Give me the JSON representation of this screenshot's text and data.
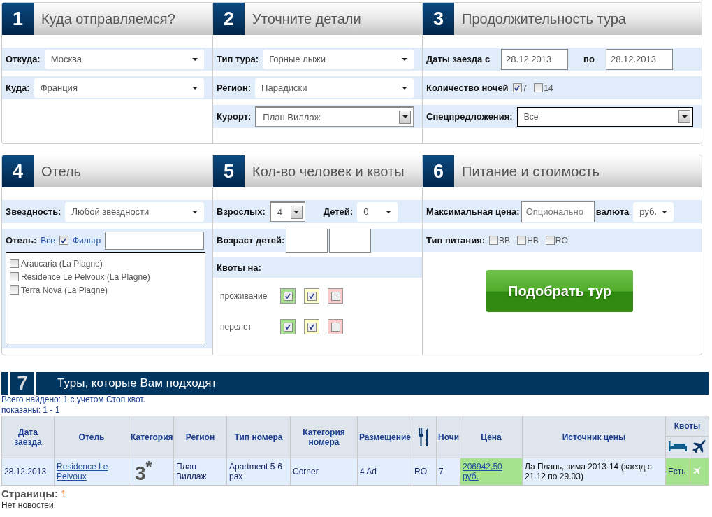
{
  "sections": [
    {
      "number": "1",
      "title": "Куда отправляемся?",
      "rows": [
        {
          "kind": "field",
          "parts": [
            {
              "kind": "label",
              "text": "Откуда:"
            },
            {
              "kind": "select",
              "value": "Москва"
            }
          ]
        },
        {
          "kind": "field",
          "parts": [
            {
              "kind": "label",
              "text": "Куда:"
            },
            {
              "kind": "select",
              "value": "Франция"
            }
          ]
        }
      ]
    },
    {
      "number": "2",
      "title": "Уточните детали",
      "rows": [
        {
          "kind": "field",
          "parts": [
            {
              "kind": "label",
              "text": "Тип тура:"
            },
            {
              "kind": "select",
              "value": "Горные лыжи"
            }
          ]
        },
        {
          "kind": "field",
          "parts": [
            {
              "kind": "label",
              "text": "Регион:"
            },
            {
              "kind": "select",
              "value": "Парадиски"
            }
          ]
        },
        {
          "kind": "field",
          "parts": [
            {
              "kind": "label",
              "text": "Курорт:"
            },
            {
              "kind": "combo",
              "value": "План Виллаж"
            }
          ]
        }
      ]
    },
    {
      "number": "3",
      "title": "Продолжительность тура",
      "rows": [
        {
          "kind": "field",
          "parts": [
            {
              "kind": "label",
              "text": "Даты заезда с"
            },
            {
              "kind": "input",
              "value": "28.12.2013"
            },
            {
              "kind": "label",
              "text": "по"
            },
            {
              "kind": "input",
              "value": "28.12.2013"
            }
          ]
        },
        {
          "kind": "field",
          "parts": [
            {
              "kind": "label",
              "text": "Количество ночей"
            },
            {
              "kind": "check",
              "text": "7",
              "checked": true
            },
            {
              "kind": "check",
              "text": "14",
              "checked": false
            }
          ]
        },
        {
          "kind": "field",
          "parts": [
            {
              "kind": "label",
              "text": "Спецпредложения:"
            },
            {
              "kind": "combo",
              "value": "Все"
            }
          ]
        }
      ]
    },
    {
      "number": "4",
      "title": "Отель",
      "rows": [
        {
          "kind": "field",
          "parts": [
            {
              "kind": "label",
              "text": "Звездность:"
            },
            {
              "kind": "select",
              "value": "Любой звездности"
            }
          ]
        },
        {
          "kind": "field",
          "parts": [
            {
              "kind": "label",
              "text": "Отель:"
            },
            {
              "kind": "link",
              "text": "Все"
            },
            {
              "kind": "check",
              "checked": true
            },
            {
              "kind": "link",
              "text": "Фильтр"
            },
            {
              "kind": "input"
            }
          ]
        },
        {
          "kind": "list",
          "items": [
            {
              "label": "Araucaria (La Plagne)",
              "checked": false
            },
            {
              "label": "Residence Le Pelvoux (La Plagne)",
              "checked": false
            },
            {
              "label": "Terra Nova (La Plagne)",
              "checked": false
            }
          ]
        }
      ]
    },
    {
      "number": "5",
      "title": "Кол-во человек и квоты",
      "rows": [
        {
          "kind": "tight",
          "parts": [
            {
              "kind": "label",
              "text": "Взрослых:"
            },
            {
              "kind": "combo",
              "value": "4"
            },
            {
              "kind": "label",
              "text": "Детей:"
            },
            {
              "kind": "select",
              "value": "0"
            }
          ]
        },
        {
          "kind": "field",
          "parts": [
            {
              "kind": "label",
              "text": "Возраст детей:"
            },
            {
              "kind": "input"
            },
            {
              "kind": "input"
            }
          ]
        },
        {
          "kind": "heading",
          "text": "Квоты на:"
        },
        {
          "kind": "quota",
          "label": "проживание",
          "checks": [
            {
              "color": "#a6df8e",
              "checked": true
            },
            {
              "color": "#ffffc8",
              "checked": true
            },
            {
              "color": "#ffcccc",
              "checked": false
            }
          ]
        },
        {
          "kind": "quota",
          "label": "перелет",
          "checks": [
            {
              "color": "#a6df8e",
              "checked": true
            },
            {
              "color": "#ffffc8",
              "checked": true
            },
            {
              "color": "#ffcccc",
              "checked": false
            }
          ]
        }
      ]
    },
    {
      "number": "6",
      "title": "Питание и стоимость",
      "rows": [
        {
          "kind": "tight",
          "parts": [
            {
              "kind": "label",
              "text": "Максимальная цена:"
            },
            {
              "kind": "input",
              "placeholder": "Опционально"
            },
            {
              "kind": "label",
              "text": "валюта"
            },
            {
              "kind": "select",
              "value": "руб."
            }
          ]
        },
        {
          "kind": "field",
          "parts": [
            {
              "kind": "label",
              "text": "Тип питания:"
            },
            {
              "kind": "check",
              "text": "BB",
              "checked": false
            },
            {
              "kind": "check",
              "text": "HB",
              "checked": false
            },
            {
              "kind": "check",
              "text": "RO",
              "checked": false
            }
          ]
        },
        {
          "kind": "action",
          "text": "Подобрать тур"
        }
      ]
    }
  ],
  "results": {
    "number": "7",
    "title": "Туры, которые Вам подходят",
    "summary": [
      "Всего найдено: 1 с учетом Стоп квот.",
      "показаны: 1 - 1"
    ],
    "table": {
      "columns": [
        {
          "kind": "text",
          "label": "Дата заезда"
        },
        {
          "kind": "text",
          "label": "Отель"
        },
        {
          "kind": "text",
          "label": "Категория"
        },
        {
          "kind": "text",
          "label": "Регион"
        },
        {
          "kind": "text",
          "label": "Тип номера"
        },
        {
          "kind": "text",
          "label": "Категория номера"
        },
        {
          "kind": "text",
          "label": "Размещение"
        },
        {
          "kind": "meal-icon"
        },
        {
          "kind": "text",
          "label": "Ночи"
        },
        {
          "kind": "text",
          "label": "Цена"
        },
        {
          "kind": "text",
          "label": "Источник цены"
        },
        {
          "kind": "group",
          "label": "Квоты",
          "subcolumns": [
            {
              "kind": "bed"
            },
            {
              "kind": "plane"
            }
          ]
        }
      ],
      "rows": [
        {
          "cells": [
            {
              "kind": "text",
              "text": "28.12.2013"
            },
            {
              "kind": "link",
              "text": "Residence Le Pelvoux"
            },
            {
              "kind": "category",
              "text": "3$^{*}$"
            },
            {
              "kind": "text",
              "text": "План Виллаж"
            },
            {
              "kind": "text",
              "text": "Apartment 5-6 pax"
            },
            {
              "kind": "text",
              "text": "Corner"
            },
            {
              "kind": "text",
              "text": "4 Ad"
            },
            {
              "kind": "text",
              "text": "RO"
            },
            {
              "kind": "text",
              "text": "7"
            },
            {
              "kind": "price",
              "text": "206942,50 руб."
            },
            {
              "kind": "source",
              "text": "Ла Плань, зима 2013-14 (заезд с 21.12 по 29.03)"
            },
            {
              "kind": "quota",
              "text": "Есть"
            },
            {
              "kind": "quota-icon"
            }
          ]
        }
      ]
    },
    "pages_label": "Страницы:",
    "pages": [
      {
        "label": "1",
        "selected": true
      }
    ],
    "news": "Нет новостей."
  }
}
